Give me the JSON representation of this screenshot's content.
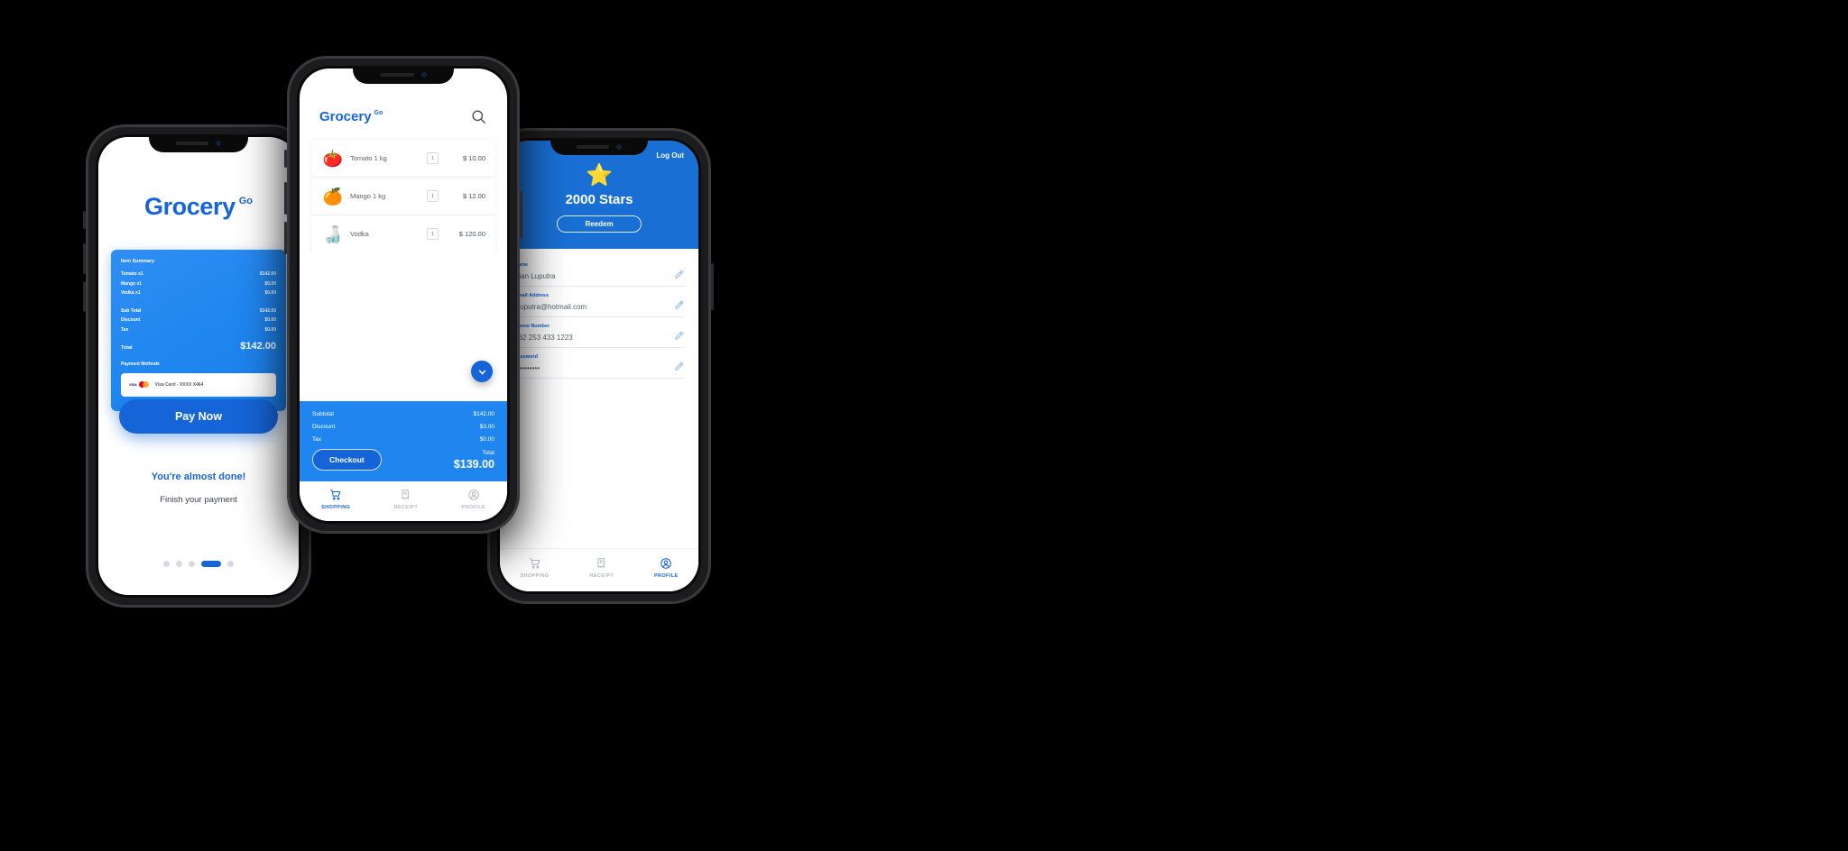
{
  "background_color": "#000000",
  "accent_blue": "#1565d8",
  "panel_blue": "#1f86f0",
  "left_phone": {
    "brand": {
      "main": "Grocery",
      "sup": "Go"
    },
    "summary": {
      "title": "Item Summary",
      "items": [
        {
          "label": "Tomato x1",
          "value": "$142.00"
        },
        {
          "label": "Mango x1",
          "value": "$0.00"
        },
        {
          "label": "Vodka x1",
          "value": "$0.00"
        }
      ],
      "totals": [
        {
          "label": "Sub Total",
          "value": "$142.00"
        },
        {
          "label": "Discount",
          "value": "$0.00"
        },
        {
          "label": "Tax",
          "value": "$0.00"
        }
      ],
      "total_label": "Total",
      "total_value": "$142.00",
      "payment_method_label": "Payment Methode",
      "card_visa": "VISA",
      "card_text": "Visa Card - XXXX X464"
    },
    "pay_button": "Pay Now",
    "almost_done": "You're almost done!",
    "finish_payment": "Finish your payment",
    "pagination": {
      "count": 5,
      "active_index": 3
    }
  },
  "center_phone": {
    "brand": {
      "main": "Grocery",
      "sup": "Go"
    },
    "search_icon": "search-icon",
    "products": [
      {
        "emoji": "🍅",
        "name": "Tomato 1 kg",
        "qty": "1",
        "price": "$ 10.00"
      },
      {
        "emoji": "🍊",
        "name": "Mango 1 kg",
        "qty": "1",
        "price": "$ 12.00"
      },
      {
        "emoji": "🍶",
        "name": "Vodka",
        "qty": "1",
        "price": "$ 120.00"
      }
    ],
    "checkout": {
      "rows": [
        {
          "label": "Subtotal",
          "value": "$142.00"
        },
        {
          "label": "Discount",
          "value": "$3.00"
        },
        {
          "label": "Tax",
          "value": "$0.00"
        }
      ],
      "button": "Checkout",
      "total_label": "Total",
      "total_value": "$139.00"
    },
    "tabs": [
      {
        "label": "SHOPPING",
        "icon": "cart-icon",
        "active": true
      },
      {
        "label": "RECEIPT",
        "icon": "receipt-icon",
        "active": false
      },
      {
        "label": "PROFILE",
        "icon": "profile-icon",
        "active": false
      }
    ]
  },
  "right_phone": {
    "log_out": "Log Out",
    "star_icon": "star-icon",
    "stars": "2000 Stars",
    "redeem": "Reedem",
    "fields": [
      {
        "label": "Name",
        "value": "Bian Luputra"
      },
      {
        "label": "Email Address",
        "value": "bluputra@hotmail.com"
      },
      {
        "label": "Phone Number",
        "value": "+62 253 433 1223"
      },
      {
        "label": "Password",
        "value": "••••••••••"
      }
    ],
    "tabs": [
      {
        "label": "SHOPPING",
        "icon": "cart-icon",
        "active": false
      },
      {
        "label": "RECEIPT",
        "icon": "receipt-icon",
        "active": false
      },
      {
        "label": "PROFILE",
        "icon": "profile-icon",
        "active": true
      }
    ]
  }
}
